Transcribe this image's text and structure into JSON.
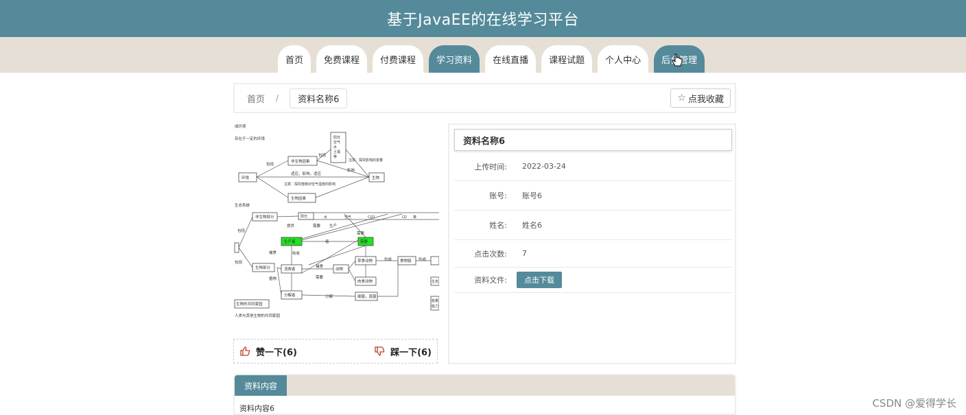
{
  "header": {
    "title": "基于JavaEE的在线学习平台"
  },
  "nav": {
    "tabs": [
      "首页",
      "免费课程",
      "付费课程",
      "学习资料",
      "在线直播",
      "课程试题",
      "个人中心",
      "后台管理"
    ],
    "active_index": 3
  },
  "breadcrumb": {
    "home": "首页",
    "separator": "/",
    "current": "资料名称6"
  },
  "favorite": {
    "label": "点我收藏"
  },
  "vote": {
    "like_label": "赞一下(6)",
    "dislike_label": "踩一下(6)"
  },
  "detail": {
    "title": "资料名称6",
    "rows": [
      {
        "label": "上传时间:",
        "value": "2022-03-24"
      },
      {
        "label": "账号:",
        "value": "账号6"
      },
      {
        "label": "姓名:",
        "value": "姓名6"
      },
      {
        "label": "点击次数:",
        "value": "7"
      }
    ],
    "file_label": "资料文件:",
    "download_label": "点击下载"
  },
  "content": {
    "tab_label": "资料内容",
    "body": "资料内容6"
  },
  "watermark": "CSDN @爱得学长",
  "diagram": {
    "labels": [
      "成环境",
      "存在于一定的环境",
      "阳光",
      "空气",
      "水",
      "土壤",
      "等",
      "非生物因素",
      "包括",
      "包括",
      "环境",
      "生物",
      "影响",
      "注意：探究影响的变量",
      "生物因素",
      "适应，影响，适应",
      "注意：探究植物对空气湿度的影响",
      "生态系统",
      "非生物部分",
      "阳光",
      "水",
      "空气",
      "CO2",
      "O2",
      "等",
      "提供",
      "生产者",
      "需要",
      "需要",
      "生产",
      "需要",
      "吸收",
      "分解",
      "者",
      "生物部分",
      "包括",
      "包括",
      "消费者",
      "植物",
      "动物",
      "捕食",
      "形成",
      "食物链",
      "食物网",
      "分解者",
      "细菌，真菌",
      "分解",
      "形成",
      "生物圈",
      "生物的共同家园",
      "人类与其他生物的共同家园",
      "被吃",
      "需要",
      "被吃",
      "草食动物",
      "肉食动物",
      "被吃",
      "营养",
      "产生",
      "能量",
      "自动",
      "调节",
      "能力",
      "生态"
    ]
  }
}
